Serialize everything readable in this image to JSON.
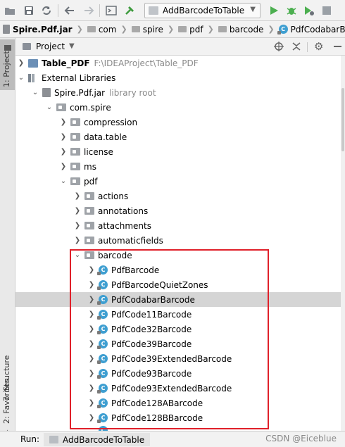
{
  "toolbar": {
    "run_config": "AddBarcodeToTable",
    "buttons": [
      "folder-icon",
      "save-icon",
      "sync-icon",
      "back-icon",
      "forward-icon",
      "terminal-icon",
      "build-icon",
      "run-icon",
      "debug-icon",
      "coverage-icon",
      "stop-icon"
    ]
  },
  "breadcrumbs": [
    "Spire.Pdf.jar",
    "com",
    "spire",
    "pdf",
    "barcode",
    "PdfCodabarBarco"
  ],
  "left_tabs": {
    "project": "1: Project",
    "structure": "7: Structure",
    "favorites": "2: Favorites"
  },
  "panel": {
    "title": "Project"
  },
  "tree": [
    {
      "label": "Table_PDF",
      "extra": "F:\\IDEAProject\\Table_PDF",
      "bold": true
    },
    {
      "label": "External Libraries"
    },
    {
      "label": "Spire.Pdf.jar",
      "extra": "library root"
    },
    {
      "label": "com.spire"
    },
    {
      "label": "compression"
    },
    {
      "label": "data.table"
    },
    {
      "label": "license"
    },
    {
      "label": "ms"
    },
    {
      "label": "pdf"
    },
    {
      "label": "actions"
    },
    {
      "label": "annotations"
    },
    {
      "label": "attachments"
    },
    {
      "label": "automaticfields"
    },
    {
      "label": "barcode"
    },
    {
      "label": "PdfBarcode"
    },
    {
      "label": "PdfBarcodeQuietZones"
    },
    {
      "label": "PdfCodabarBarcode"
    },
    {
      "label": "PdfCode11Barcode"
    },
    {
      "label": "PdfCode32Barcode"
    },
    {
      "label": "PdfCode39Barcode"
    },
    {
      "label": "PdfCode39ExtendedBarcode"
    },
    {
      "label": "PdfCode93Barcode"
    },
    {
      "label": "PdfCode93ExtendedBarcode"
    },
    {
      "label": "PdfCode128ABarcode"
    },
    {
      "label": "PdfCode128BBarcode"
    }
  ],
  "bottom": {
    "run_label": "Run:",
    "run_tab": "AddBarcodeToTable",
    "watermark": "CSDN @Eiceblue"
  },
  "colors": {
    "highlight": "#e0202a",
    "class_icon": "#3f9fd1",
    "selection": "#d5d5d5"
  }
}
